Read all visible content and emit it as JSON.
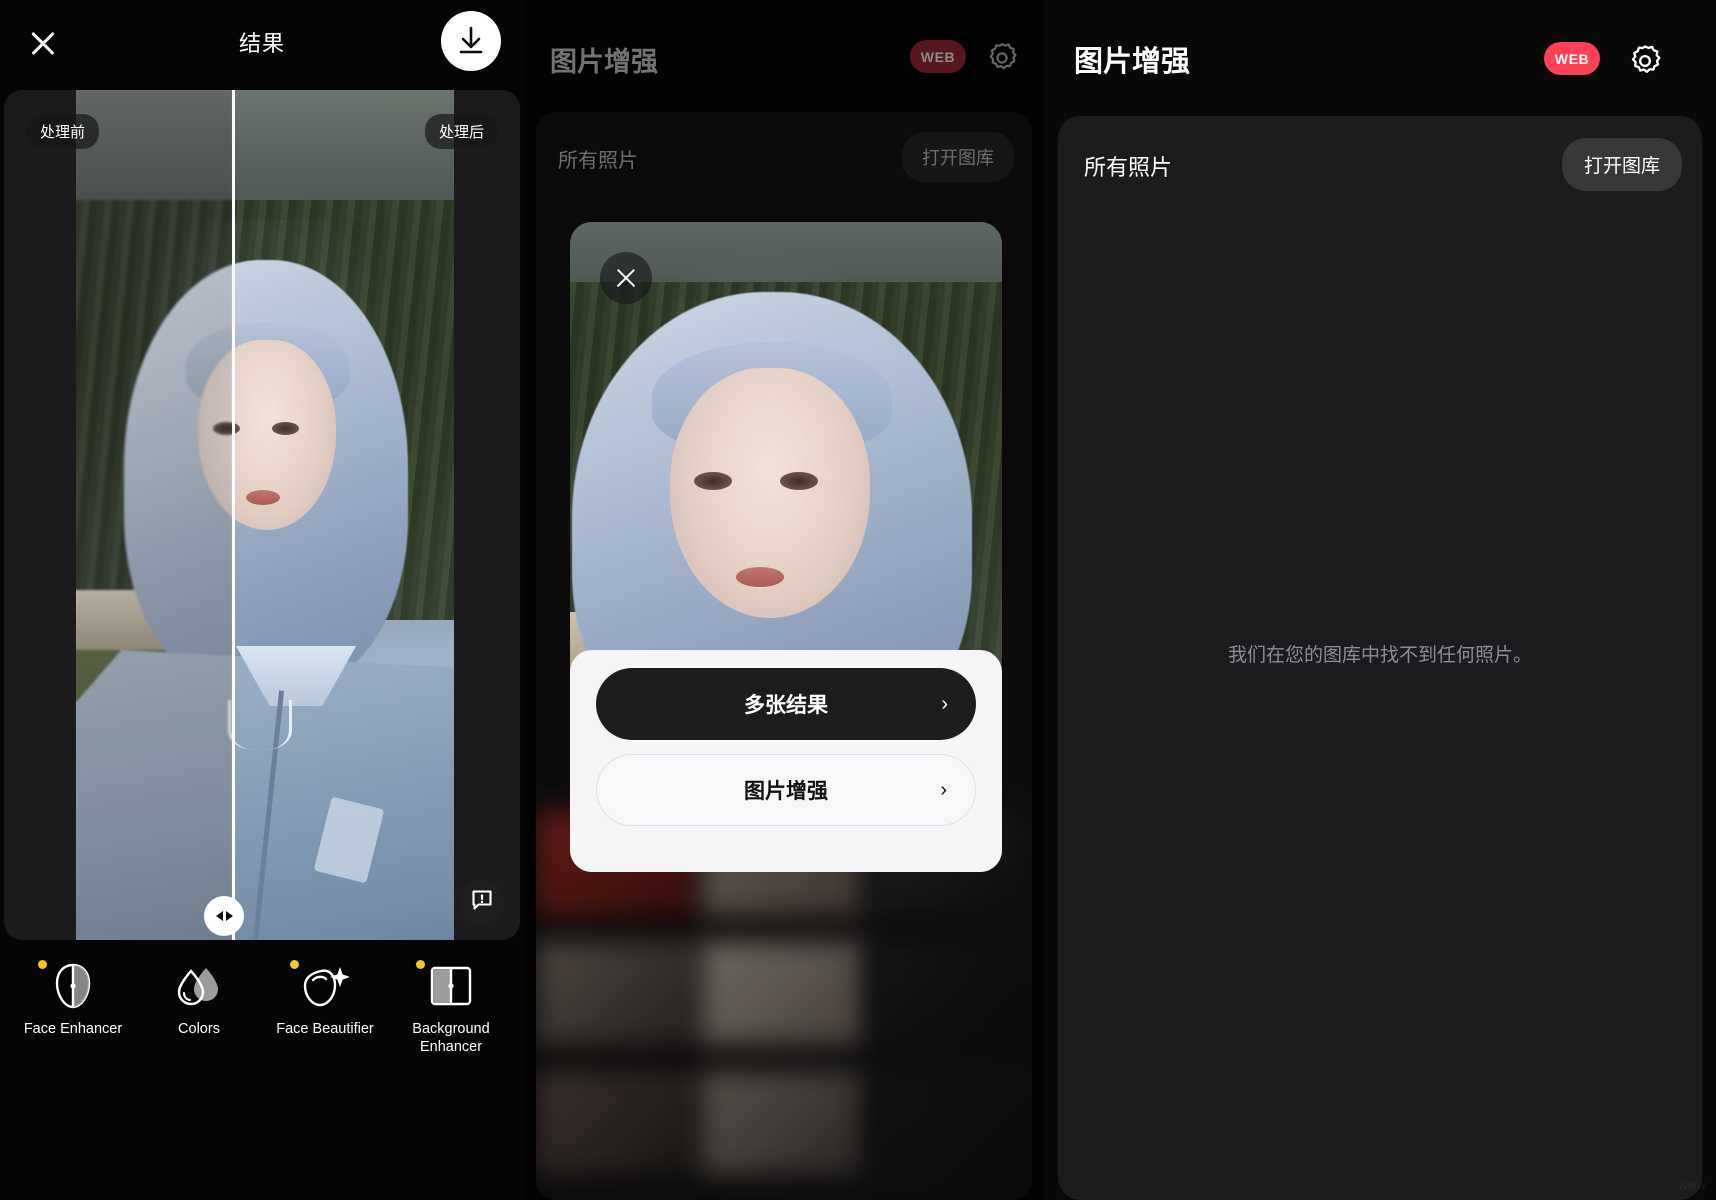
{
  "result_panel": {
    "title": "结果",
    "close_icon": "close-icon",
    "download_icon": "download-icon",
    "before_badge": "处理前",
    "after_badge": "处理后",
    "slider_handle_icon": "left-right-chevrons-icon",
    "feedback_icon": "feedback-chat-icon",
    "tools": [
      {
        "label": "Face Enhancer",
        "icon": "face-split-icon",
        "dot": true
      },
      {
        "label": "Colors",
        "icon": "color-drops-icon",
        "dot": false
      },
      {
        "label": "Face Beautifier",
        "icon": "face-sparkle-icon",
        "dot": true
      },
      {
        "label": "Background Enhancer",
        "icon": "background-split-icon",
        "dot": true
      }
    ]
  },
  "gallery_dim_panel": {
    "title": "图片增强",
    "web_badge": "WEB",
    "gear_icon": "gear-icon",
    "all_photos_label": "所有照片",
    "open_gallery_button": "打开图库"
  },
  "modal": {
    "close_icon": "close-icon",
    "actions": [
      {
        "label": "多张结果",
        "arrow": "›",
        "style": "primary"
      },
      {
        "label": "图片增强",
        "arrow": "›",
        "style": "secondary"
      }
    ]
  },
  "gallery_panel": {
    "title": "图片增强",
    "web_badge": "WEB",
    "gear_icon": "gear-icon",
    "all_photos_label": "所有照片",
    "open_gallery_button": "打开图库",
    "empty_message": "我们在您的图库中找不到任何照片。",
    "watermark": "www"
  },
  "colors": {
    "accent_red": "#FF4155",
    "accent_red_dim": "#A32C38",
    "dot_yellow": "#F7C325",
    "panel_bg": "#09090A",
    "card_bg": "#1C1C1E",
    "sheet_bg": "#F5F5F7"
  }
}
